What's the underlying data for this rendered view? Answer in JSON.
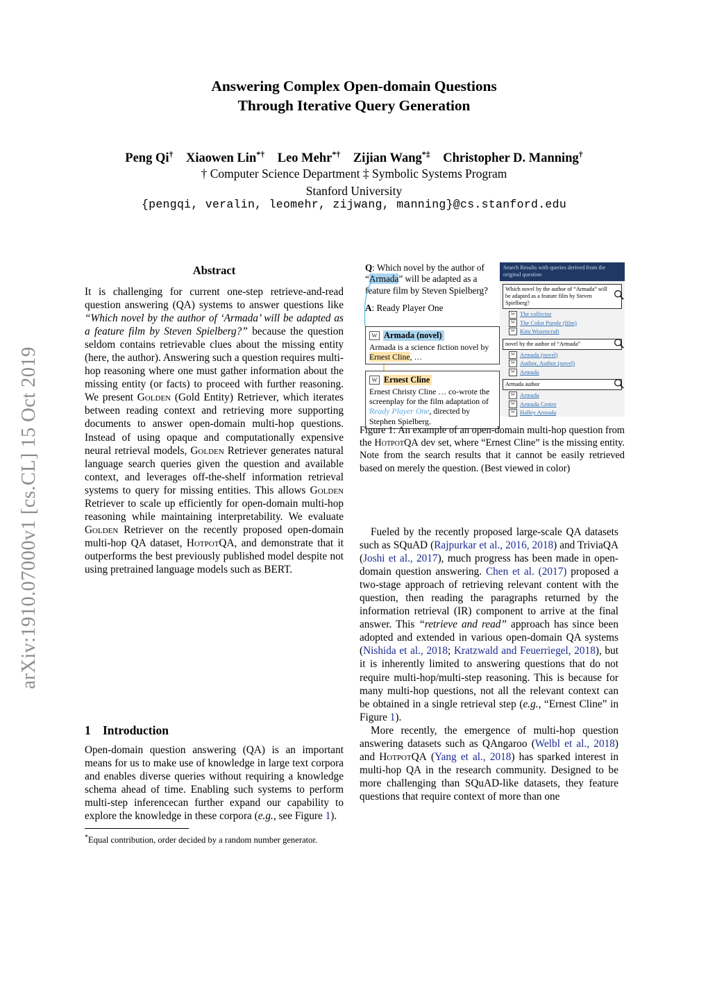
{
  "arxiv_stamp": "arXiv:1910.07000v1  [cs.CL]  15 Oct 2019",
  "paper": {
    "title_line1": "Answering Complex Open-domain Questions",
    "title_line2": "Through Iterative Query Generation",
    "authors": [
      {
        "name": "Peng Qi",
        "marks": "†"
      },
      {
        "name": "Xiaowen Lin",
        "marks": "*†"
      },
      {
        "name": "Leo Mehr",
        "marks": "*†"
      },
      {
        "name": "Zijian Wang",
        "marks": "*‡"
      },
      {
        "name": "Christopher D. Manning",
        "marks": "†"
      }
    ],
    "affiliation_line": "† Computer Science Department    ‡ Symbolic Systems Program",
    "institution": "Stanford University",
    "emails": "{pengqi, veralin, leomehr, zijwang, manning}@cs.stanford.edu"
  },
  "abstract": {
    "heading": "Abstract",
    "part1": "It is challenging for current one-step retrieve-and-read question answering (QA) systems to answer questions like ",
    "quote": "“Which novel by the author of ‘Armada’ will be adapted as a feature film by Steven Spielberg?”",
    "part2": " because the question seldom contains retrievable clues about the missing entity (here, the author). Answering such a question requires multi-hop reasoning where one must gather information about the missing entity (or facts) to proceed with further reasoning. We present ",
    "golden1": "Golden",
    "part3": " (Gold Entity) Retriever, which iterates between reading context and retrieving more supporting documents to answer open-domain multi-hop questions. Instead of using opaque and computationally expensive neural retrieval models, ",
    "golden2": "Golden",
    "part4": " Retriever generates natural language search queries given the question and available context, and leverages off-the-shelf information retrieval systems to query for missing entities. This allows ",
    "golden3": "Golden",
    "part5": " Retriever to scale up efficiently for open-domain multi-hop reasoning while maintaining interpretability. We evaluate ",
    "golden4": "Golden",
    "part6": " Retriever on the recently proposed open-domain multi-hop QA dataset, ",
    "hotpot1": "HotpotQA",
    "part7": ", and demonstrate that it outperforms the best previously published model despite not using pretrained language models such as BERT."
  },
  "introduction": {
    "number": "1",
    "heading": "Introduction",
    "para1": "Open-domain question answering (QA) is an important means for us to make use of knowledge in large text corpora and enables diverse queries without requiring a knowledge schema ahead of time. Enabling such systems to perform multi-step inferencecan further expand our capability to explore the knowledge in these corpora (",
    "para1_eg": "e.g.",
    "para1_b": ", see Figure ",
    "para1_ref": "1",
    "para1_end": ")."
  },
  "footnote": {
    "star": "*",
    "text": "Equal contribution, order decided by a random number generator."
  },
  "right_column": {
    "para1_a": "Fueled by the recently proposed large-scale QA datasets such as SQuAD (",
    "cite1": "Rajpurkar et al., 2016, 2018",
    "para1_b": ") and TriviaQA (",
    "cite2": "Joshi et al., 2017",
    "para1_c": "), much progress has been made in open-domain question answering. ",
    "cite3": "Chen et al. (2017)",
    "para1_d": " proposed a two-stage approach of retrieving relevant content with the question, then reading the paragraphs returned by the information retrieval (IR) component to arrive at the final answer. This ",
    "para1_quote": "“retrieve and read”",
    "para1_e": " approach has since been adopted and extended in various open-domain QA systems (",
    "cite4": "Nishida et al., 2018",
    "para1_f": "; ",
    "cite5": "Kratzwald and Feuerriegel, 2018",
    "para1_g": "), but it is inherently limited to answering questions that do not require multi-hop/multi-step reasoning. This is because for many multi-hop questions, not all the relevant context can be obtained in a single retrieval step (",
    "para1_eg": "e.g.",
    "para1_h": ", “Ernest Cline” in Figure ",
    "ref1": "1",
    "para1_i": ").",
    "para2_a": "More recently, the emergence of multi-hop question answering datasets such as QAngaroo (",
    "cite6": "Welbl et al., 2018",
    "para2_b": ") and ",
    "hotpot": "HotpotQA",
    "para2_c": " (",
    "cite7": "Yang et al., 2018",
    "para2_d": ") has sparked interest in multi-hop QA in the research community. Designed to be more challenging than SQuAD-like datasets, they feature questions that require context of more than one"
  },
  "figure": {
    "caption_a": "Figure 1: An example of an open-domain multi-hop question from the ",
    "caption_hotpot": "HotpotQA",
    "caption_b": " dev set, where “Ernest Cline” is the missing entity. Note from the search results that it cannot be easily retrieved based on merely the question. (Best viewed in color)",
    "question_label": "Q",
    "question_a": ": Which novel by the author of “",
    "question_highlight": "Armada",
    "question_b": "” will be adapted as a feature film by Steven Spielberg?",
    "answer_label": "A",
    "answer_text": ": Ready Player One",
    "doc1": {
      "icon": "wikipedia-icon",
      "title": "Armada (novel)",
      "body_a": "Armada is a science fiction novel by ",
      "body_entity": "Ernest Cline",
      "body_b": ", …"
    },
    "doc2": {
      "icon": "wikipedia-icon",
      "title": "Ernest Cline",
      "body_a": "Ernest Christy Cline … co-wrote the screenplay for the film adaptation of ",
      "body_film": "Ready Player One",
      "body_b": ", directed by Stephen Spielberg."
    },
    "search_panel": {
      "header": "Search Results with queries derived from the original question",
      "groups": [
        {
          "query": "Which novel by the author of “Armada” will be adapted as a feature film by Steven Spielberg?",
          "results": [
            "The collector",
            "The Color Purple (film)",
            "Kim Wozencraft"
          ]
        },
        {
          "query": "novel by the author of “Armada”",
          "results": [
            "Armada (novel)",
            "Author, Author (novel)",
            "Armada"
          ]
        },
        {
          "query": "Armada author",
          "results": [
            "Armada",
            "Armada Centre",
            "Halley Armada"
          ]
        }
      ]
    }
  },
  "colors": {
    "header_navy": "#1f3864",
    "header_text": "#c7d6ef",
    "link_blue": "#2f6fb5",
    "cite_blue": "#1b2a8f",
    "highlight_blue": "#aad4ee",
    "highlight_orange": "#fde3ab",
    "panel_gray": "#f2f2f2",
    "stamp_gray": "#8c8c8c"
  }
}
